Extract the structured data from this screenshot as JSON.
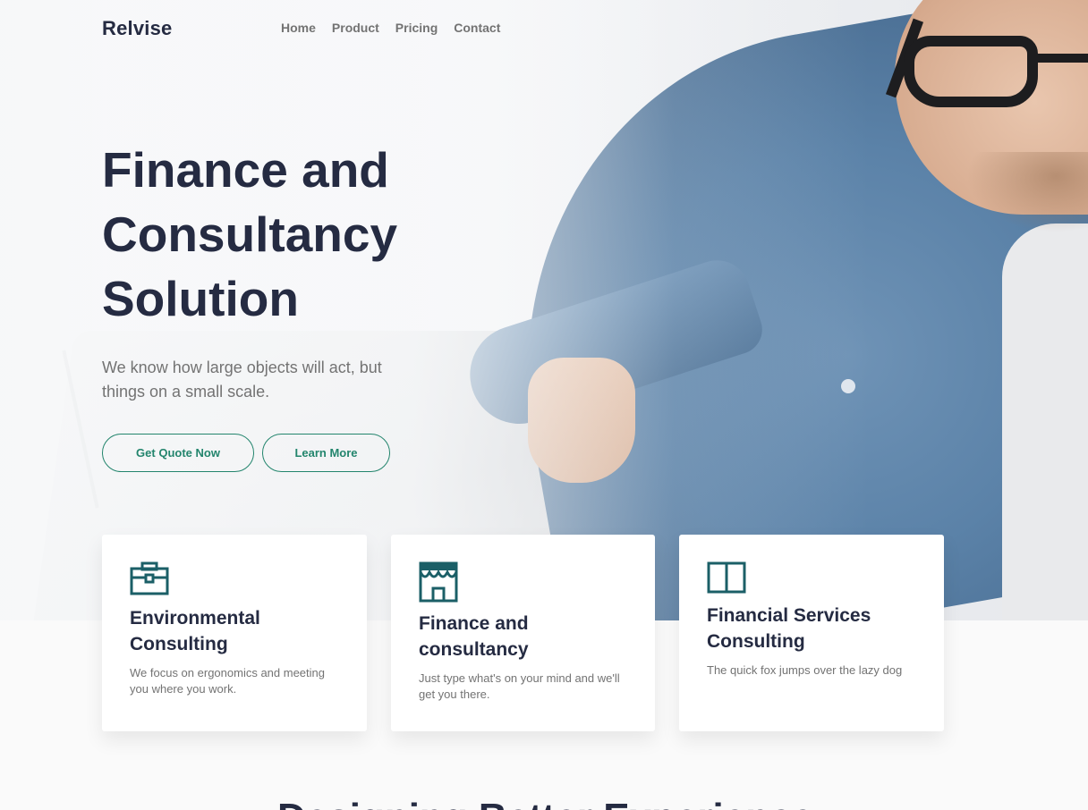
{
  "brand": "Relvise",
  "nav": {
    "items": [
      "Home",
      "Product",
      "Pricing",
      "Contact"
    ]
  },
  "hero": {
    "title_lines": [
      "Finance and",
      "Consultancy",
      "Solution"
    ],
    "subtitle": "We know how large objects will act, but things on a small scale.",
    "primary_button": "Get Quote Now",
    "secondary_button": "Learn More"
  },
  "cards": [
    {
      "icon": "briefcase-icon",
      "title": "Environmental Consulting",
      "text": "We focus on ergonomics and meeting you where you work."
    },
    {
      "icon": "storefront-icon",
      "title": "Finance and consultancy",
      "text": "Just type what's on your mind and we'll get you there."
    },
    {
      "icon": "book-icon",
      "title": "Financial Services Consulting",
      "text": "The quick fox jumps over the lazy dog"
    }
  ],
  "next_section_heading": "Designing Better Experience",
  "colors": {
    "primary_text": "#252b42",
    "muted_text": "#737373",
    "accent": "#23856d",
    "icon": "#1b5f67",
    "card_bg": "#ffffff",
    "page_bg": "#fafafa"
  }
}
